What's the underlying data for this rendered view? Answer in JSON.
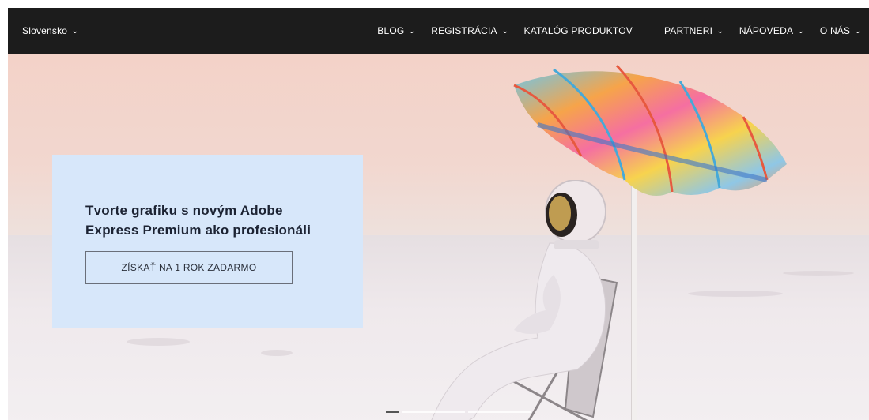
{
  "nav": {
    "region": {
      "label": "Slovensko",
      "icon": "chevron-down-icon"
    },
    "items": [
      {
        "label": "BLOG",
        "has_dropdown": true
      },
      {
        "label": "REGISTRÁCIA",
        "has_dropdown": true
      },
      {
        "label": "KATALÓG PRODUKTOV",
        "has_dropdown": false
      },
      {
        "label": "PARTNERI",
        "has_dropdown": true
      },
      {
        "label": "NÁPOVEDA",
        "has_dropdown": true
      },
      {
        "label": "O NÁS",
        "has_dropdown": true
      }
    ]
  },
  "hero": {
    "title": "Tvorte grafiku s novým Adobe Express Premium ako profesionáli",
    "cta_label": "ZÍSKAŤ NA 1 ROK ZADARMO"
  },
  "carousel": {
    "slides": 3,
    "active_index": 0
  },
  "colors": {
    "nav_bg": "#1c1c1c",
    "nav_text": "#ffffff",
    "promo_bg": "#d7e7fa",
    "promo_text": "#1c2333"
  }
}
